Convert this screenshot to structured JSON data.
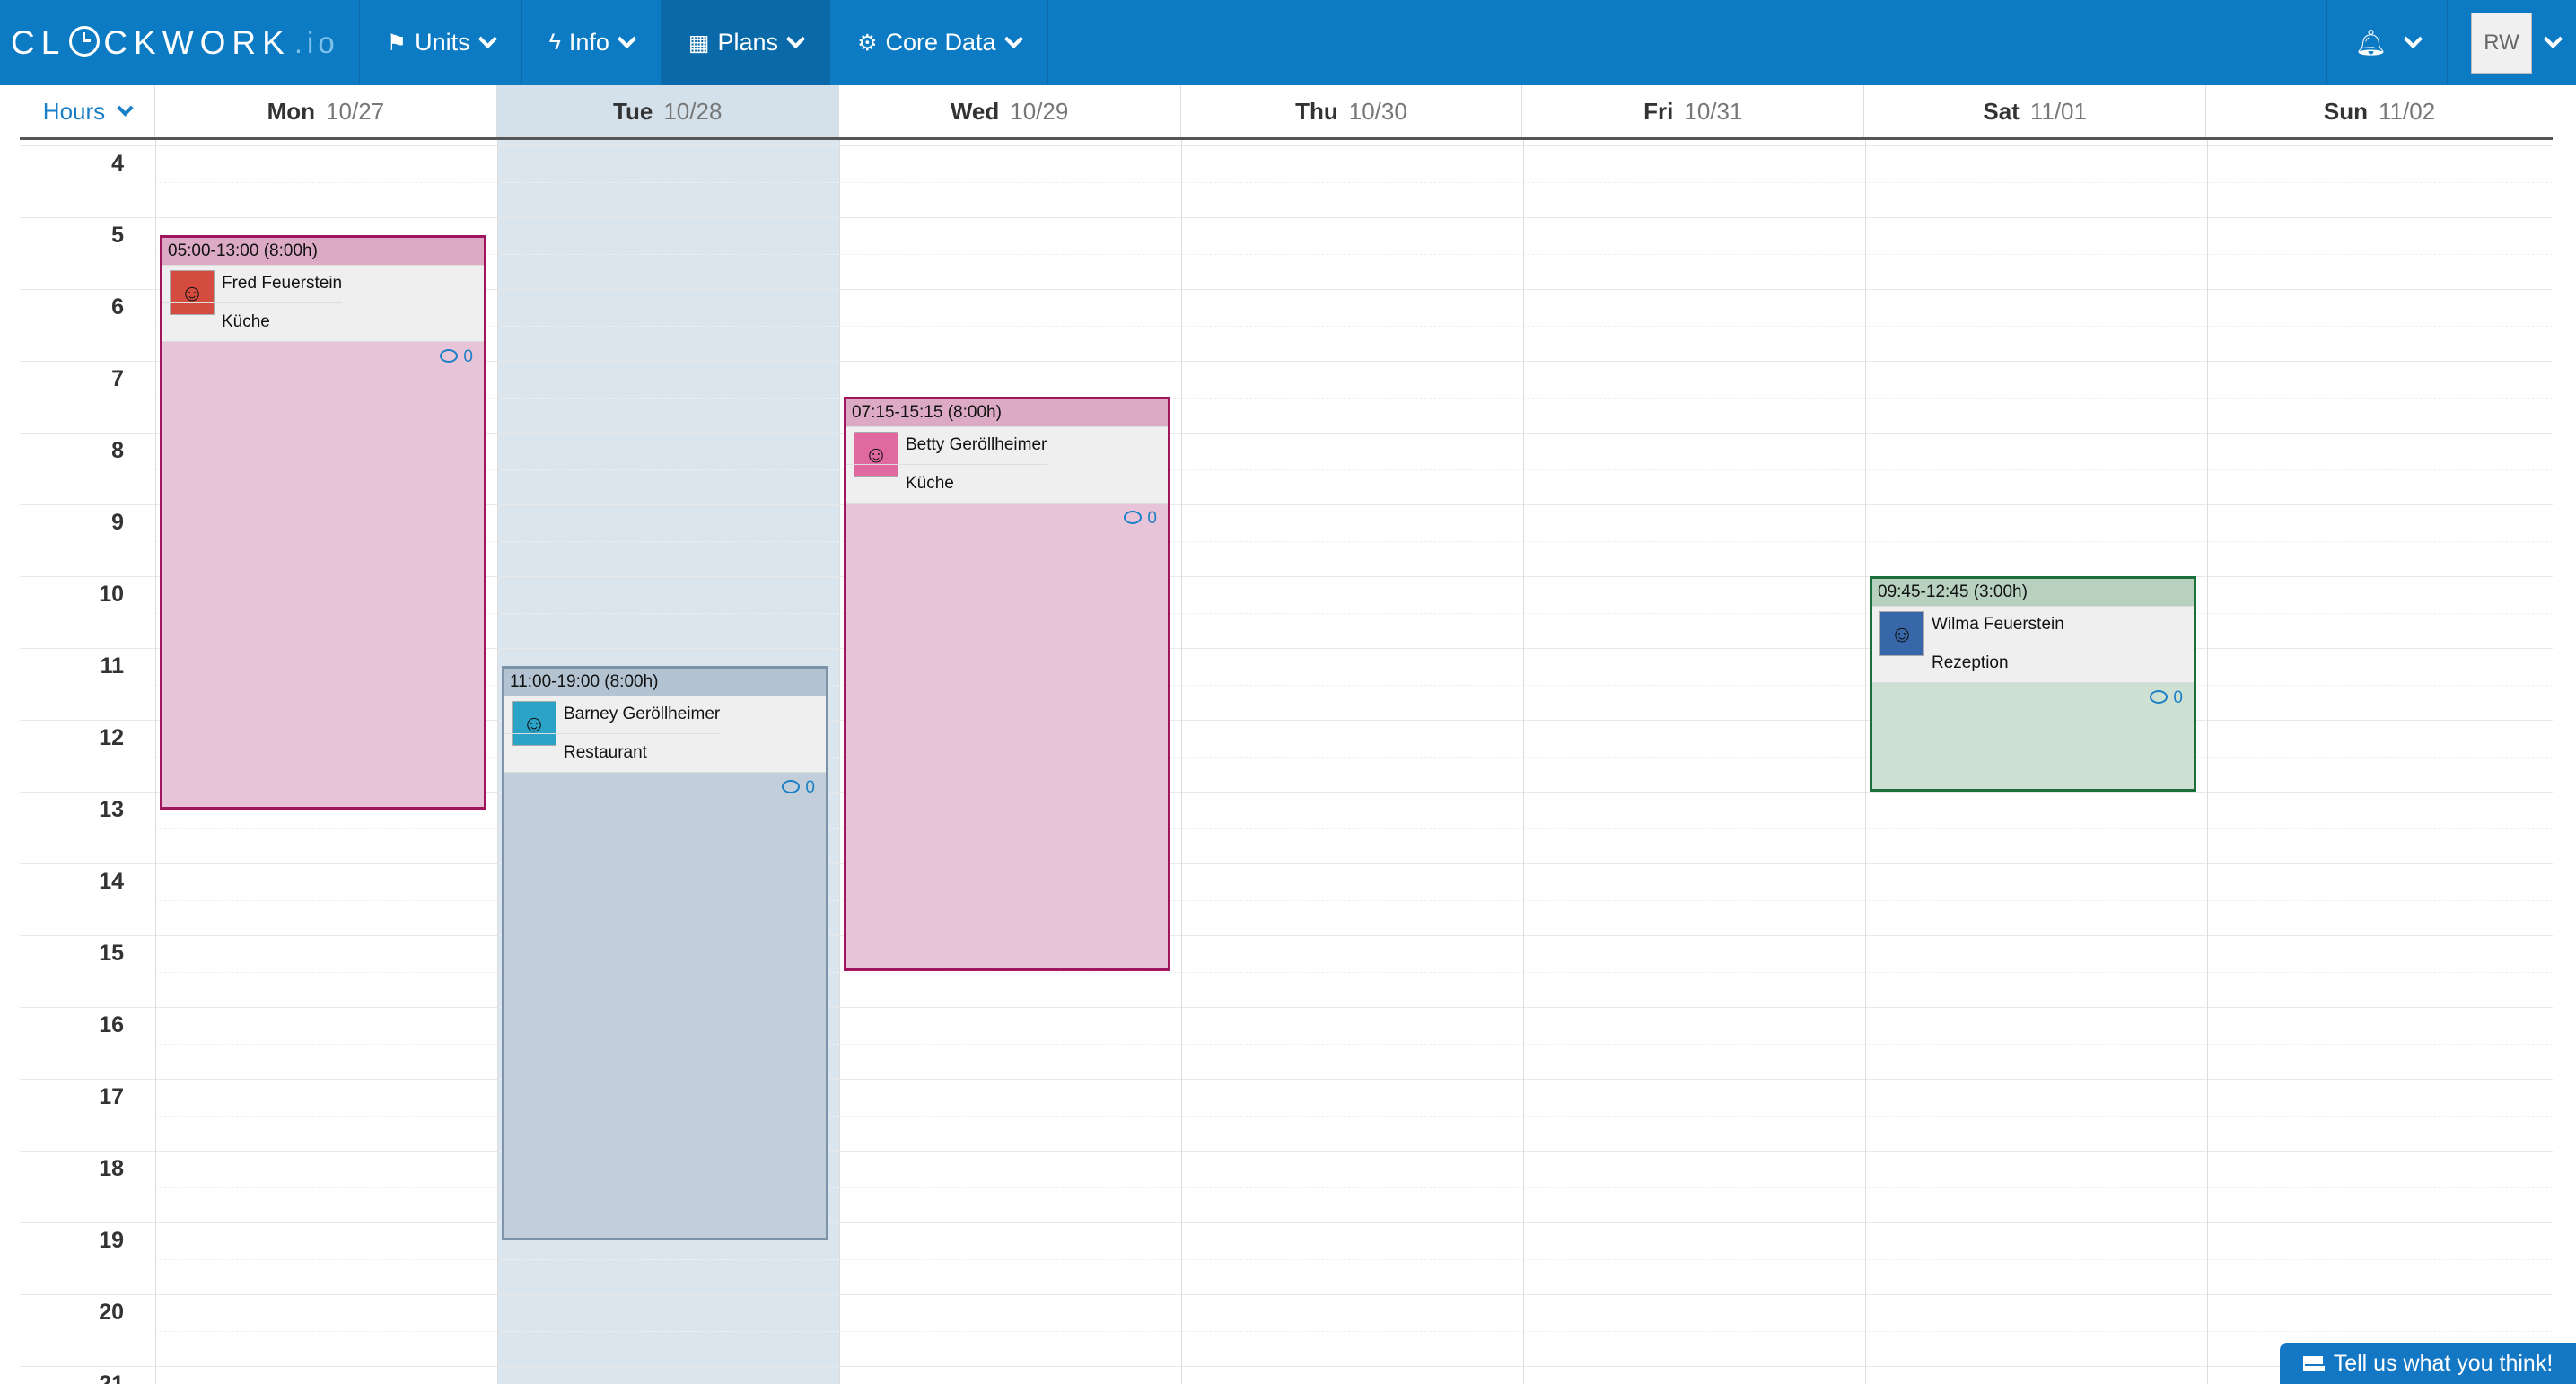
{
  "brand": {
    "name_before": "CL",
    "name_after": "CKWORK",
    "tld": ".io"
  },
  "nav": {
    "items": [
      {
        "label": "Units",
        "icon": "flag-icon"
      },
      {
        "label": "Info",
        "icon": "bolt-icon"
      },
      {
        "label": "Plans",
        "icon": "calendar-icon"
      },
      {
        "label": "Core Data",
        "icon": "gear-icon"
      }
    ],
    "user_initials": "RW"
  },
  "calendar": {
    "hours_label": "Hours",
    "days": [
      {
        "name": "Mon",
        "date": "10/27"
      },
      {
        "name": "Tue",
        "date": "10/28"
      },
      {
        "name": "Wed",
        "date": "10/29"
      },
      {
        "name": "Thu",
        "date": "10/30"
      },
      {
        "name": "Fri",
        "date": "10/31"
      },
      {
        "name": "Sat",
        "date": "11/01"
      },
      {
        "name": "Sun",
        "date": "11/02"
      }
    ],
    "hours": [
      "4",
      "5",
      "6",
      "7",
      "8",
      "9",
      "10",
      "11",
      "12",
      "13",
      "14",
      "15",
      "16",
      "17",
      "18",
      "19",
      "20",
      "21"
    ]
  },
  "shifts": [
    {
      "time": "05:00-13:00 (8:00h)",
      "name": "Fred Feuerstein",
      "unit": "Küche",
      "comments": "0",
      "color": "#a0165e"
    },
    {
      "time": "11:00-19:00 (8:00h)",
      "name": "Barney Geröllheimer",
      "unit": "Restaurant",
      "comments": "0",
      "color": "#7d93aa"
    },
    {
      "time": "07:15-15:15 (8:00h)",
      "name": "Betty Geröllheimer",
      "unit": "Küche",
      "comments": "0",
      "color": "#a0165e"
    },
    {
      "time": "09:45-12:45 (3:00h)",
      "name": "Wilma Feuerstein",
      "unit": "Rezeption",
      "comments": "0",
      "color": "#1c6e3a"
    }
  ],
  "feedback": {
    "label": "Tell us what you think!"
  }
}
